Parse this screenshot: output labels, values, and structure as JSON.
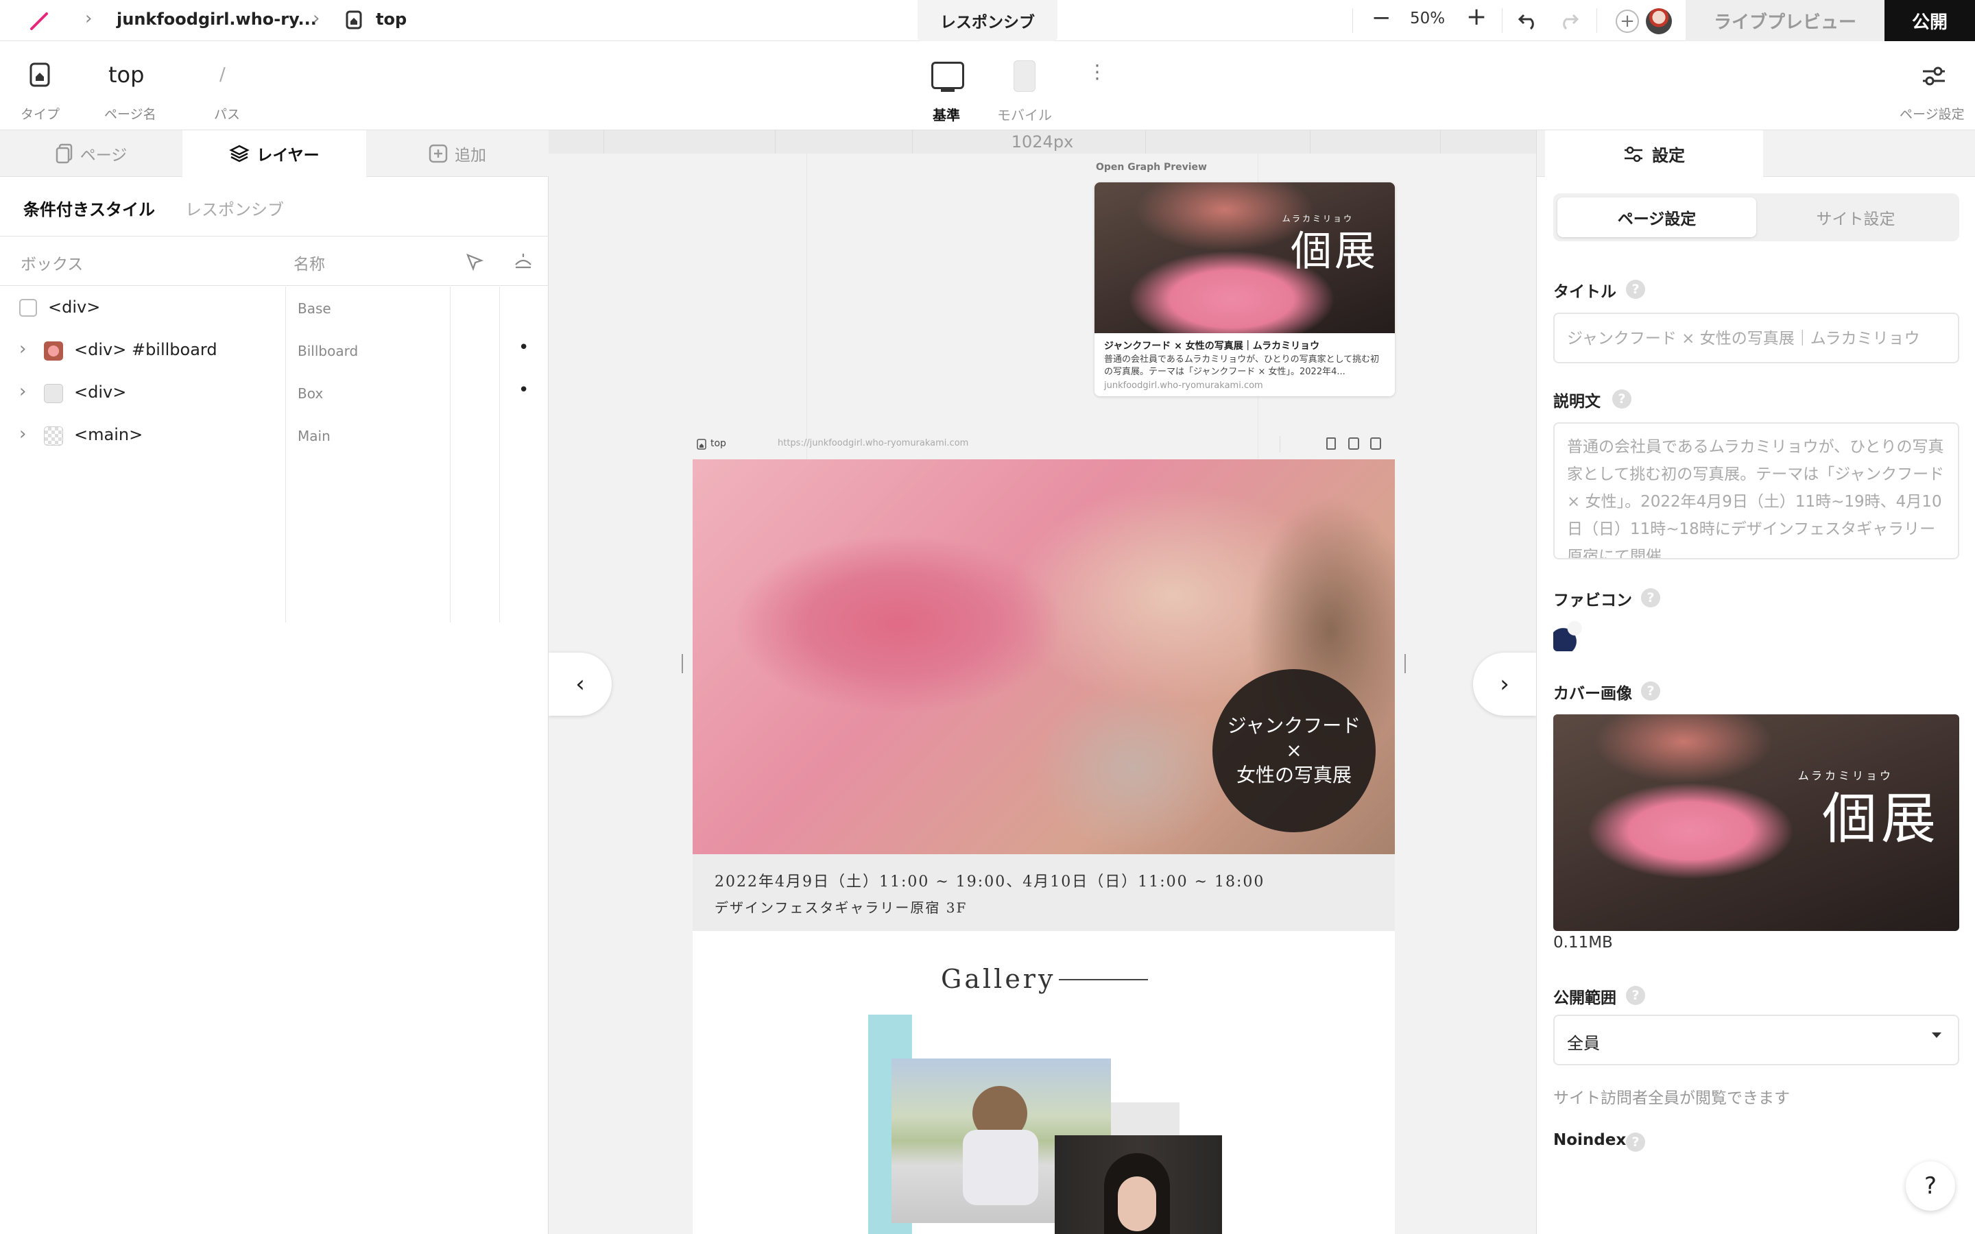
{
  "topbar": {
    "breadcrumb_site": "junkfoodgirl.who-ry...",
    "breadcrumb_page": "top",
    "mode_label": "レスポンシブ",
    "zoom": "50%",
    "preview_label": "ライブプレビュー",
    "publish_label": "公開"
  },
  "toolbar": {
    "type_label": "タイプ",
    "page_name_value": "top",
    "page_name_label": "ページ名",
    "path_value": "/",
    "path_label": "パス",
    "device_base_label": "基準",
    "device_mobile_label": "モバイル",
    "page_settings_label": "ページ設定"
  },
  "left": {
    "tabs": [
      {
        "label": "ページ"
      },
      {
        "label": "レイヤー"
      },
      {
        "label": "追加"
      }
    ],
    "subtabs": [
      "条件付きスタイル",
      "レスポンシブ"
    ],
    "col_box": "ボックス",
    "col_name": "名称",
    "rows": [
      {
        "tag": "<div>",
        "name": "Base",
        "dot": ""
      },
      {
        "tag": "<div> #billboard",
        "name": "Billboard",
        "dot": "•"
      },
      {
        "tag": "<div>",
        "name": "Box",
        "dot": "•"
      },
      {
        "tag": "<main>",
        "name": "Main",
        "dot": ""
      }
    ]
  },
  "canvas": {
    "ruler_label": "1024px",
    "og_label": "Open Graph Preview",
    "og_img_sub": "ムラカミリョウ",
    "og_img_title": "個展",
    "og_title": "ジャンクフード × 女性の写真展｜ムラカミリョウ",
    "og_desc": "普通の会社員であるムラカミリョウが、ひとりの写真家として挑む初の写真展。テーマは「ジャンクフード × 女性」。2022年4...",
    "og_domain": "junkfoodgirl.who-ryomurakami.com",
    "frame_page": "top",
    "frame_url": "https://junkfoodgirl.who-ryomurakami.com",
    "hero_circle_1": "ジャンクフード",
    "hero_circle_2": "×",
    "hero_circle_3": "女性の写真展",
    "event_date": "2022年4月9日（土）11:00 ~ 19:00、4月10日（日）11:00 ~ 18:00",
    "event_place": "デザインフェスタギャラリー原宿 3F",
    "gallery_title": "Gallery"
  },
  "right": {
    "tab_label": "設定",
    "seg_page": "ページ設定",
    "seg_site": "サイト設定",
    "title_label": "タイトル",
    "title_placeholder": "ジャンクフード × 女性の写真展｜ムラカミリョウ",
    "desc_label": "説明文",
    "desc_placeholder": "普通の会社員であるムラカミリョウが、ひとりの写真家として挑む初の写真展。テーマは「ジャンクフード × 女性」。2022年4月9日（土）11時~19時、4月10日（日）11時~18時にデザインフェスタギャラリー原宿にて開催",
    "favicon_label": "ファビコン",
    "cover_label": "カバー画像",
    "cover_img_sub": "ムラカミリョウ",
    "cover_img_title": "個展",
    "cover_size": "0.11MB",
    "visibility_label": "公開範囲",
    "visibility_value": "全員",
    "visibility_note": "サイト訪問者全員が閲覧できます",
    "noindex_label": "Noindex",
    "help_glyph": "?"
  },
  "help_button": "?"
}
